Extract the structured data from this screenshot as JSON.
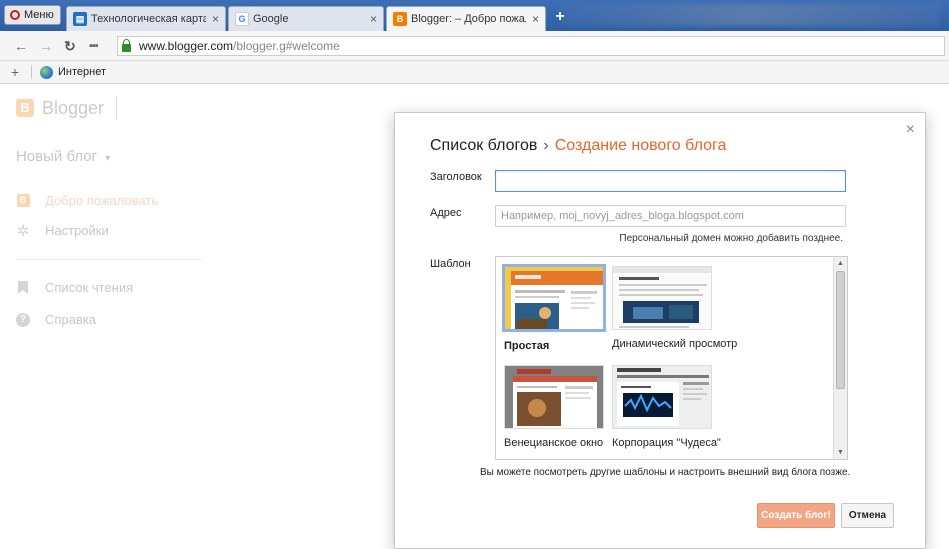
{
  "browser": {
    "menu_label": "Меню",
    "tabs": [
      {
        "label": "Технологическая карта -",
        "close": "×"
      },
      {
        "label": "Google",
        "close": "×"
      },
      {
        "label": "Blogger: – Добро пожало",
        "close": "×"
      }
    ],
    "new_tab": "+",
    "url_domain": "www.blogger.com",
    "url_path": "/blogger.g#welcome",
    "bookmark_add": "+",
    "bookmark_label": "Интернет"
  },
  "blogger": {
    "logo_letter": "B",
    "brand": "Blogger",
    "new_blog": "Новый блог",
    "new_blog_caret": "▾",
    "nav": [
      {
        "label": "Добро пожаловать",
        "icon": "blogger-icon"
      },
      {
        "label": "Настройки",
        "icon": "gear-icon"
      },
      {
        "label": "Список чтения",
        "icon": "bookmark-icon"
      },
      {
        "label": "Справка",
        "icon": "help-icon"
      }
    ]
  },
  "dialog": {
    "close": "×",
    "crumb_parent": "Список блогов",
    "crumb_sep": "›",
    "crumb_current": "Создание нового блога",
    "title_label": "Заголовок",
    "title_value": "",
    "address_label": "Адрес",
    "address_placeholder": "Например, moj_novyj_adres_bloga.blogspot.com",
    "domain_hint": "Персональный домен можно добавить позднее.",
    "template_label": "Шаблон",
    "templates": [
      {
        "name": "Простая",
        "selected": true
      },
      {
        "name": "Динамический просмотр",
        "selected": false
      },
      {
        "name": "Венецианское окно",
        "selected": false
      },
      {
        "name": "Корпорация \"Чудеса\"",
        "selected": false
      }
    ],
    "template_hint": "Вы можете посмотреть другие шаблоны и настроить внешний вид блога позже.",
    "create_button": "Создать блог!",
    "cancel_button": "Отмена"
  },
  "colors": {
    "accent": "#e8642c",
    "blogger_orange": "#f57d00",
    "focus_border": "#4d90fe",
    "create_button_bg": "#f4a586"
  }
}
